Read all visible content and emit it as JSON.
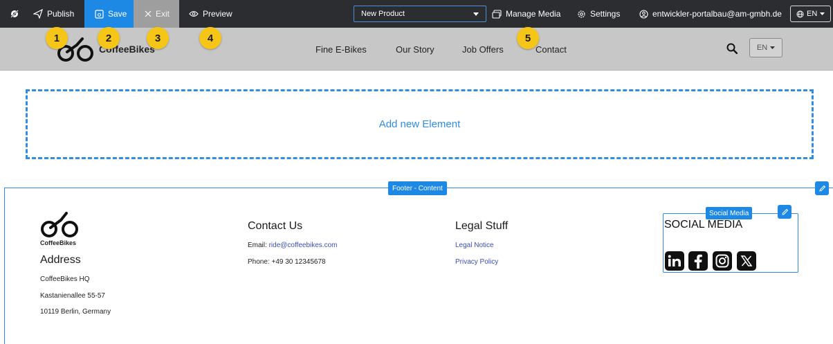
{
  "toolbar": {
    "publish": "Publish",
    "save": "Save",
    "exit": "Exit",
    "preview": "Preview",
    "product_select": "New Product",
    "manage_media": "Manage Media",
    "settings": "Settings",
    "user_email": "entwickler-portalbau@am-gmbh.de",
    "language": "EN"
  },
  "badges": [
    "1",
    "2",
    "3",
    "4",
    "5"
  ],
  "site": {
    "brand": "CoffeeBikes",
    "nav": [
      "Fine E-Bikes",
      "Our Story",
      "Job Offers",
      "Contact"
    ],
    "language": "EN"
  },
  "dropzone": {
    "label": "Add new Element"
  },
  "footer": {
    "tag": "Footer - Content",
    "brand_small": "CoffeeBikes",
    "address": {
      "heading": "Address",
      "lines": [
        "CoffeeBikes HQ",
        "Kastanienallee 55-57",
        "10119 Berlin, Germany"
      ]
    },
    "contact": {
      "heading": "Contact Us",
      "email_label": "Email:",
      "email": "ride@coffeebikes.com",
      "phone": "Phone: +49 30 12345678"
    },
    "legal": {
      "heading": "Legal Stuff",
      "links": [
        "Legal Notice",
        "Privacy Policy"
      ]
    },
    "social": {
      "tag": "Social Media",
      "heading": "SOCIAL MEDIA",
      "icons": [
        "linkedin-icon",
        "facebook-icon",
        "instagram-icon",
        "x-icon"
      ]
    }
  },
  "colors": {
    "toolbar_bg": "#2b2d30",
    "save_bg": "#1e88e5",
    "exit_bg": "#9e9e9e",
    "accent": "#2f8de4",
    "badge": "#f5c518",
    "header_bg": "#c7c7c7"
  }
}
